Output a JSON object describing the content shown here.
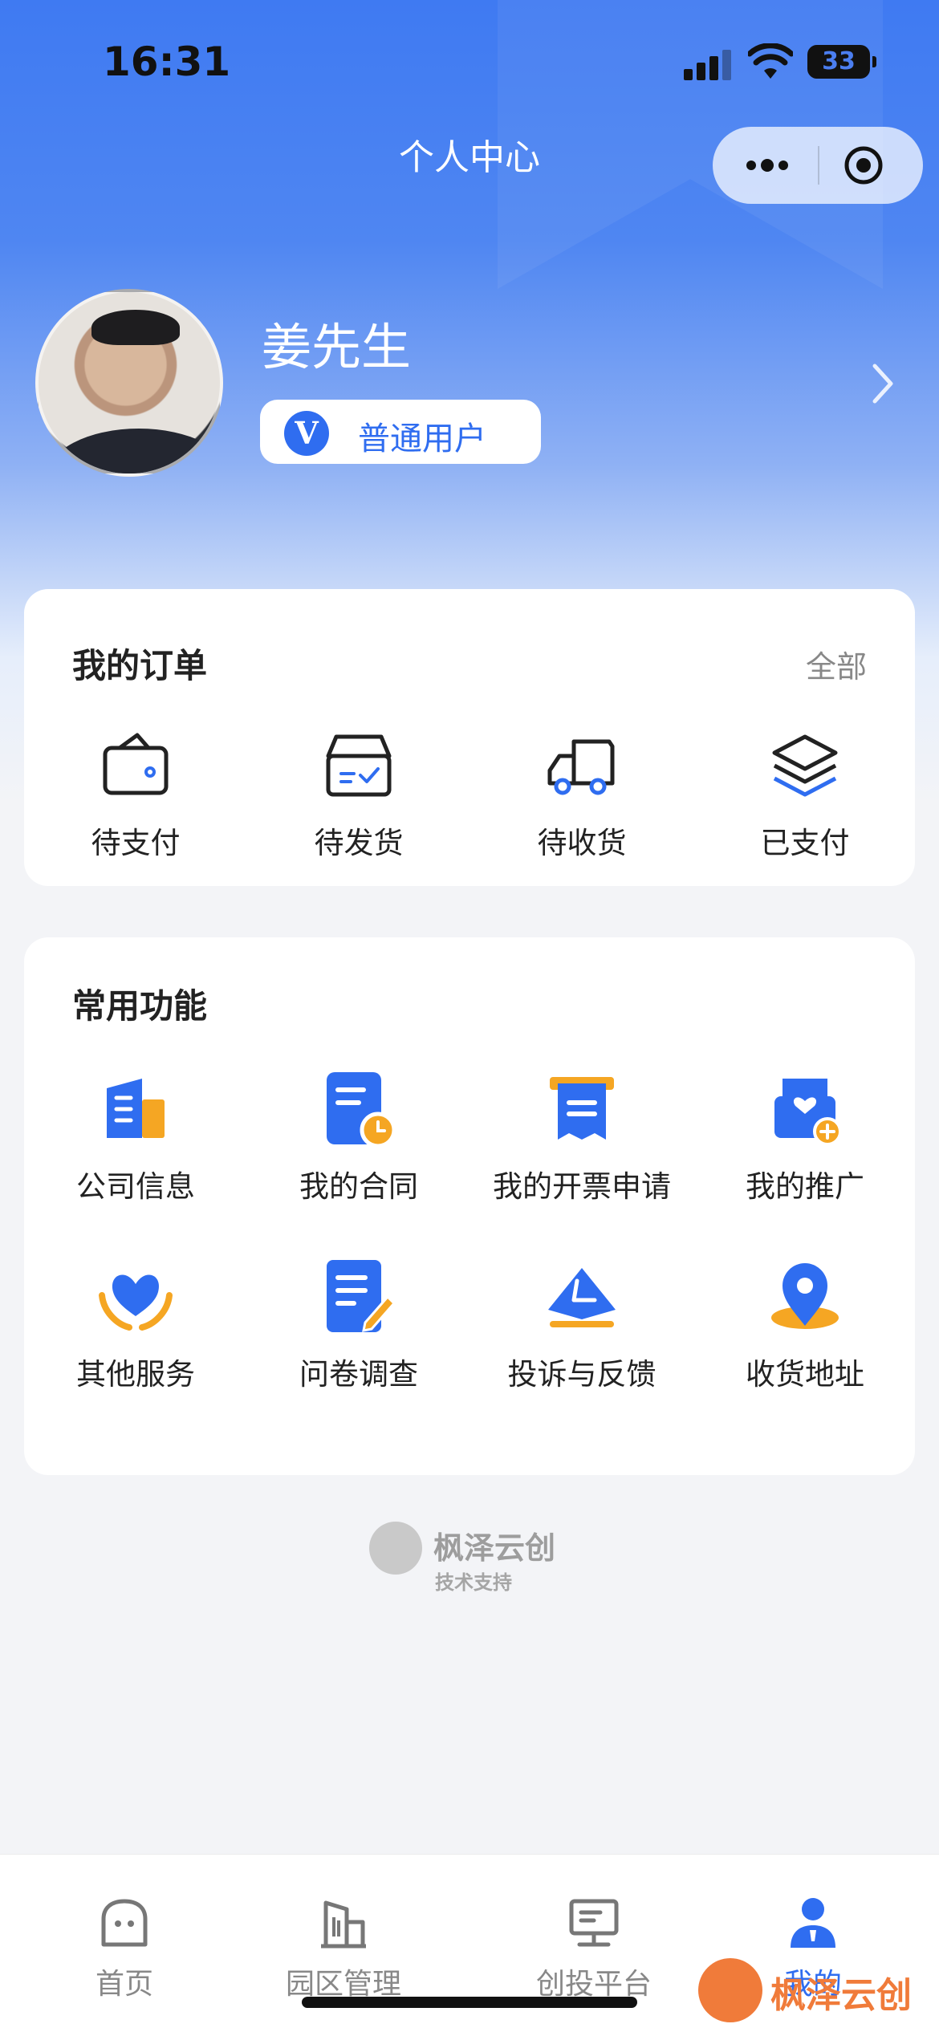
{
  "status_bar": {
    "time": "16:31",
    "battery": "33"
  },
  "header": {
    "title": "个人中心"
  },
  "profile": {
    "name": "姜先生",
    "member_badge_icon": "V",
    "member_label": "普通用户"
  },
  "orders": {
    "title": "我的订单",
    "view_all": "全部",
    "items": [
      {
        "label": "待支付",
        "icon": "wallet-icon"
      },
      {
        "label": "待发货",
        "icon": "box-icon"
      },
      {
        "label": "待收货",
        "icon": "truck-icon"
      },
      {
        "label": "已支付",
        "icon": "layers-icon"
      }
    ]
  },
  "functions": {
    "title": "常用功能",
    "items": [
      {
        "label": "公司信息",
        "icon": "building-icon"
      },
      {
        "label": "我的合同",
        "icon": "contract-icon"
      },
      {
        "label": "我的开票申请",
        "icon": "invoice-icon"
      },
      {
        "label": "我的推广",
        "icon": "promotion-icon"
      },
      {
        "label": "其他服务",
        "icon": "heart-hands-icon"
      },
      {
        "label": "问卷调查",
        "icon": "survey-icon"
      },
      {
        "label": "投诉与反馈",
        "icon": "feedback-icon"
      },
      {
        "label": "收货地址",
        "icon": "location-icon"
      }
    ]
  },
  "footer": {
    "brand": "枫泽云创",
    "support": "技术支持"
  },
  "tabbar": {
    "items": [
      {
        "label": "首页",
        "icon": "home-icon",
        "active": false
      },
      {
        "label": "园区管理",
        "icon": "park-icon",
        "active": false
      },
      {
        "label": "创投平台",
        "icon": "platform-icon",
        "active": false
      },
      {
        "label": "我的",
        "icon": "user-icon",
        "active": true
      }
    ]
  },
  "watermark": {
    "text": "枫泽云创"
  },
  "colors": {
    "primary": "#2f6df0",
    "accent": "#f5a623",
    "watermark": "#f07b3a"
  }
}
